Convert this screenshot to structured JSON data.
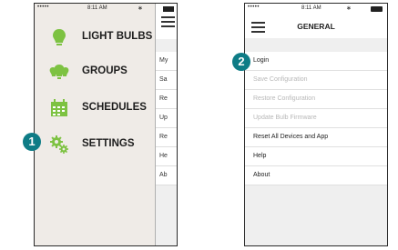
{
  "status_bar": {
    "signal": "•••••",
    "time": "8:11 AM",
    "bluetooth": "∗"
  },
  "drawer": {
    "items": [
      {
        "label": "LIGHT BULBS",
        "icon": "lightbulb-icon"
      },
      {
        "label": "GROUPS",
        "icon": "group-bulbs-icon"
      },
      {
        "label": "SCHEDULES",
        "icon": "calendar-icon"
      },
      {
        "label": "SETTINGS",
        "icon": "gears-icon"
      }
    ],
    "icon_color": "#7dc242"
  },
  "behind_list": [
    "My",
    "Sa",
    "Re",
    "Up",
    "Re",
    "He",
    "Ab"
  ],
  "callouts": {
    "first": "1",
    "second": "2",
    "color": "#0e7c86"
  },
  "general": {
    "title": "GENERAL",
    "items": [
      {
        "label": "Login",
        "enabled": true
      },
      {
        "label": "Save Configuration",
        "enabled": false
      },
      {
        "label": "Restore Configuration",
        "enabled": false
      },
      {
        "label": "Update Bulb Firmware",
        "enabled": false
      },
      {
        "label": "Reset All Devices and App",
        "enabled": true
      },
      {
        "label": "Help",
        "enabled": true
      },
      {
        "label": "About",
        "enabled": true
      }
    ]
  }
}
